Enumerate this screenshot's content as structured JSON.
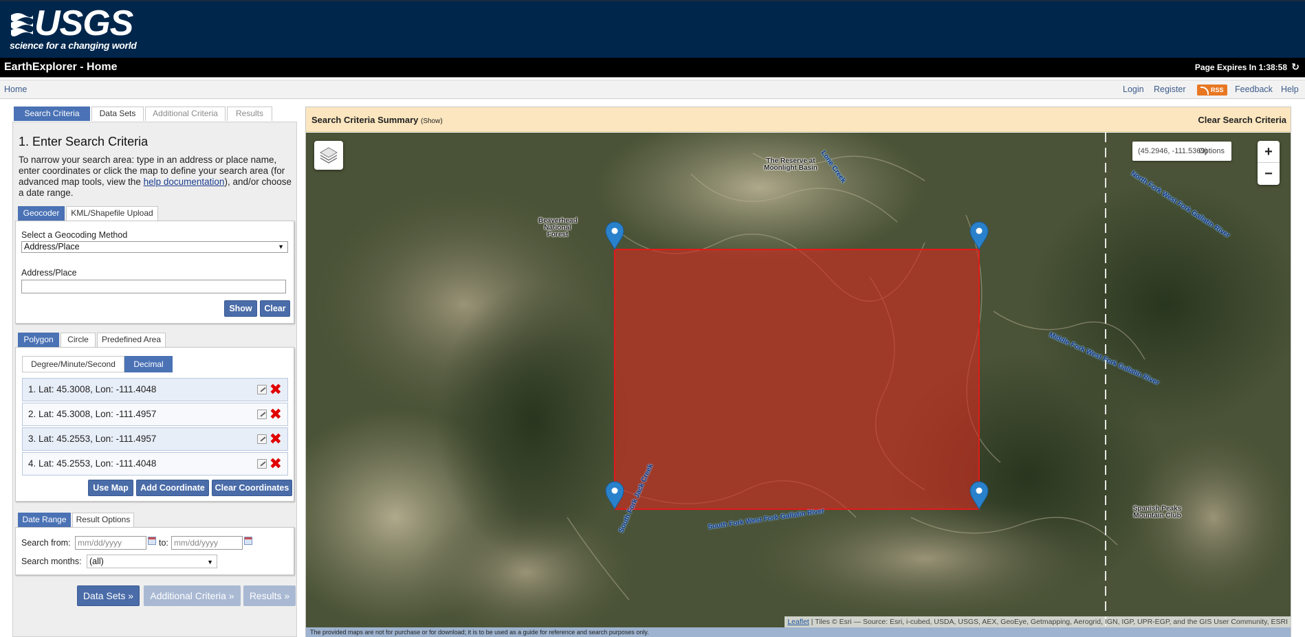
{
  "header": {
    "logo_text": "USGS",
    "logo_tagline": "science for a changing world",
    "app_title": "EarthExplorer - Home",
    "page_expires": "Page Expires In 1:38:58",
    "refresh_icon": "refresh-icon"
  },
  "nav": {
    "home": "Home",
    "login": "Login",
    "register": "Register",
    "rss": "RSS",
    "feedback": "Feedback",
    "help": "Help"
  },
  "main_tabs": [
    {
      "label": "Search Criteria",
      "active": true
    },
    {
      "label": "Data Sets",
      "active": false
    },
    {
      "label": "Additional Criteria",
      "active": false
    },
    {
      "label": "Results",
      "active": false
    }
  ],
  "criteria": {
    "heading": "1. Enter Search Criteria",
    "desc_before": "To narrow your search area: type in an address or place name, enter coordinates or click the map to define your search area (for advanced map tools, view the ",
    "desc_link": "help documentation",
    "desc_after": "), and/or choose a date range."
  },
  "geocoder": {
    "tabs": [
      "Geocoder",
      "KML/Shapefile Upload"
    ],
    "method_label": "Select a Geocoding Method",
    "method_value": "Address/Place",
    "address_label": "Address/Place",
    "address_value": "",
    "show_button": "Show",
    "clear_button": "Clear"
  },
  "area": {
    "tabs": [
      "Polygon",
      "Circle",
      "Predefined Area"
    ],
    "format_options": [
      "Degree/Minute/Second",
      "Decimal"
    ],
    "format_selected": "Decimal",
    "coordinates": [
      "1.  Lat: 45.3008, Lon: -111.4048",
      "2.  Lat: 45.3008, Lon: -111.4957",
      "3.  Lat: 45.2553, Lon: -111.4957",
      "4.  Lat: 45.2553, Lon: -111.4048"
    ],
    "use_map_button": "Use Map",
    "add_coordinate_button": "Add Coordinate",
    "clear_coordinates_button": "Clear Coordinates"
  },
  "date": {
    "tabs": [
      "Date Range",
      "Result Options"
    ],
    "from_label": "Search from:",
    "from_placeholder": "mm/dd/yyyy",
    "to_label": "to:",
    "to_placeholder": "mm/dd/yyyy",
    "months_label": "Search months:",
    "months_value": "(all)"
  },
  "bottom_buttons": {
    "data_sets": "Data Sets »",
    "additional_criteria": "Additional Criteria »",
    "results": "Results »"
  },
  "map": {
    "summary_title": "Search Criteria Summary",
    "summary_show": "(Show)",
    "clear_search": "Clear Search Criteria",
    "coord_readout": "(45.2946, -111.5369)",
    "options": "Options",
    "zoom_in": "+",
    "zoom_out": "−",
    "attribution_link": "Leaflet",
    "attribution_text": " | Tiles © Esri — Source: Esri, i-cubed, USDA, USGS, AEX, GeoEye, Getmapping, Aerogrid, IGN, IGP, UPR-EGP, and the GIS User Community, ESRI",
    "disclaimer": "The provided maps are not for purchase or for download; it is to be used as a guide for reference and search purposes only.",
    "labels": {
      "reserve": "The Reserve at Moonlight Basin",
      "lone_creek": "Lone Creek",
      "beaverhead": "Beaverhead National Forest",
      "north_fork": "North Fork West Fork Gallatin River",
      "middle_fork": "Middle Fork West Fork Gallatin River",
      "south_fork_jack": "South Fork Jack Creek",
      "south_fork_gallatin": "South Fork West Fork Gallatin River",
      "spanish_peaks": "Spanish Peaks Mountain Club"
    },
    "polygon_color": "#d32a1e",
    "marker_color": "#2a81cb"
  }
}
